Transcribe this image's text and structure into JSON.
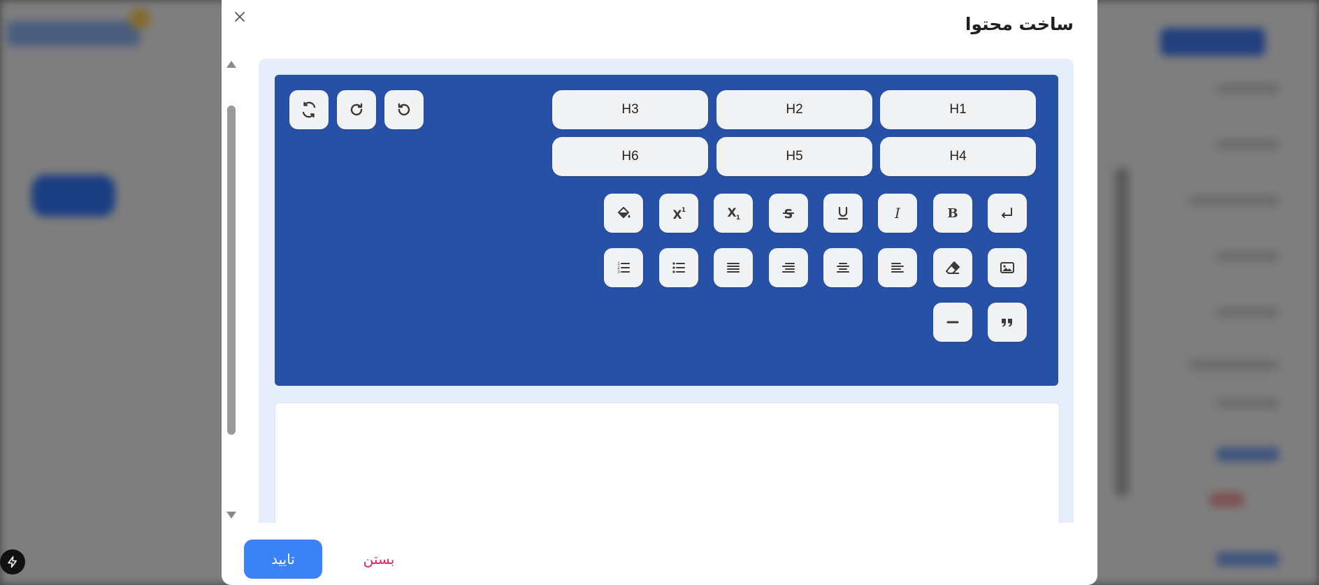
{
  "modal": {
    "title": "ساخت محتوا",
    "confirm_label": "تایید",
    "close_label": "بستن"
  },
  "toolbar": {
    "headings": [
      "H1",
      "H2",
      "H3",
      "H4",
      "H5",
      "H6"
    ],
    "history_icons": [
      "undo-icon",
      "redo-icon",
      "refresh-icon"
    ],
    "format_icons_row1": [
      "line-break-icon",
      "bold-icon",
      "italic-icon",
      "underline-icon",
      "strikethrough-icon",
      "subscript-icon",
      "superscript-icon",
      "paint-bucket-icon"
    ],
    "format_icons_row2": [
      "image-icon",
      "eraser-icon",
      "align-left-icon",
      "align-center-icon",
      "align-right-icon",
      "align-justify-icon",
      "bullet-list-icon",
      "numbered-list-icon"
    ],
    "format_icons_row3": [
      "quote-icon",
      "horizontal-rule-icon"
    ]
  },
  "colors": {
    "toolbar_bg": "#2651a6",
    "editor_bg": "#e6eefb",
    "confirm_bg": "#3b82f6",
    "close_text": "#e0245e"
  }
}
